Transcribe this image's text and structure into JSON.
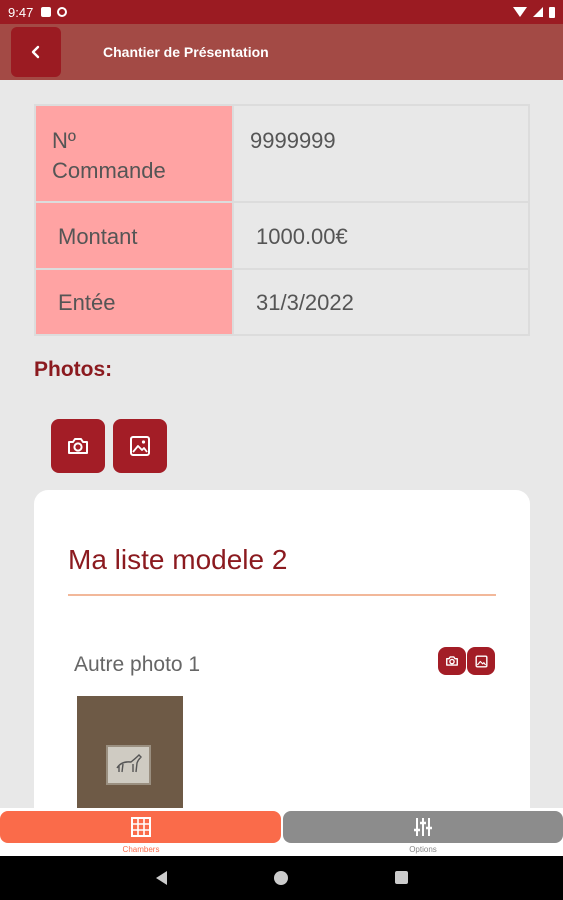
{
  "status_bar": {
    "time": "9:47"
  },
  "app_bar": {
    "back_icon": "chevron-left-icon",
    "title": "Chantier de Présentation"
  },
  "info": {
    "rows": [
      {
        "label": "Nº Commande",
        "value": "9999999"
      },
      {
        "label": "Montant",
        "value": "1000.00€"
      },
      {
        "label": "Entée",
        "value": "31/3/2022"
      }
    ]
  },
  "photos": {
    "heading": "Photos:",
    "camera_icon": "camera-icon",
    "gallery_icon": "image-icon"
  },
  "card": {
    "title": "Ma liste modele 2",
    "photo_label": "Autre photo 1"
  },
  "bottom_nav": {
    "tabs": [
      {
        "label": "Chambers",
        "icon": "grid-icon"
      },
      {
        "label": "Options",
        "icon": "sliders-icon"
      }
    ]
  },
  "colors": {
    "primary": "#9b1b22",
    "app_bar": "#a34a45",
    "label_bg": "#ffa3a3",
    "active_tab": "#fa6b4a",
    "inactive_tab": "#8c8c8c"
  }
}
